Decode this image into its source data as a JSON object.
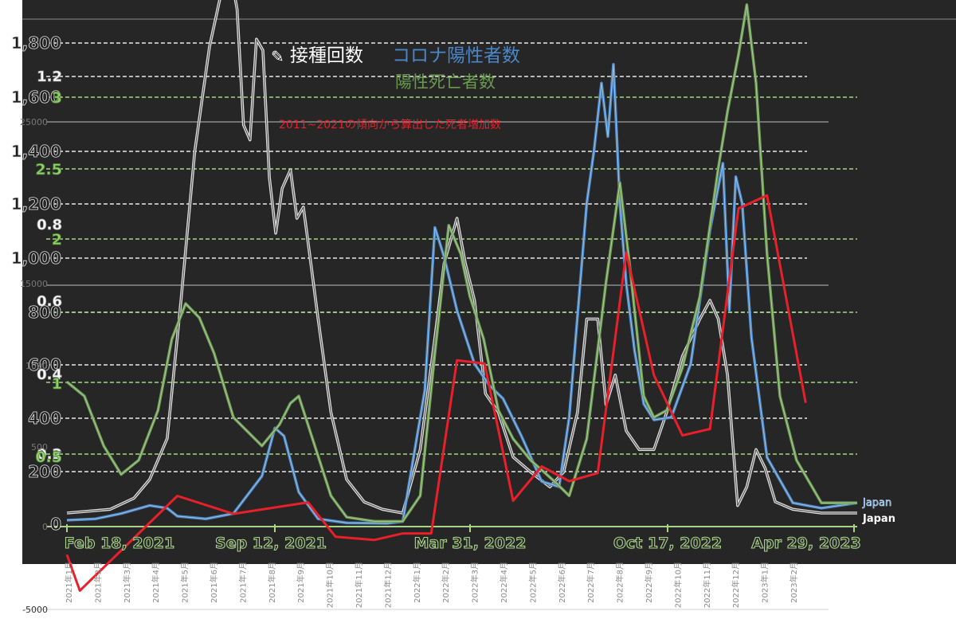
{
  "chart_data": {
    "type": "line",
    "legend": {
      "vaccinations": "接種回数",
      "cases": "コロナ陽性者数",
      "deaths": "陽性死亡者数",
      "excess": "2011~2021の傾向から算出した死者増加数"
    },
    "colors": {
      "vaccinations": "#f2f2f2",
      "cases": "#4a86c8",
      "deaths": "#6a9a50",
      "excess": "#e8202a",
      "background": "#262626",
      "grid_white": "#e8e8e8",
      "grid_green": "#a8d48a"
    },
    "axes": {
      "left_main_ticks": [
        "0",
        "200",
        "400",
        "600",
        "800",
        "1,000",
        "1,200",
        "1,400",
        "1,600",
        "1,800"
      ],
      "left_million_ticks": [
        "0.2",
        "0.4",
        "0.6",
        "0.8",
        "1.2"
      ],
      "left_green_ticks": [
        "0.5",
        "1",
        "2",
        "2.5",
        "3"
      ],
      "left_excess_ticks": [
        "0",
        "500",
        "1000",
        "15000",
        "25000",
        "-5000"
      ],
      "date_labels": [
        "Feb 18, 2021",
        "Sep 12, 2021",
        "Mar 31, 2022",
        "Oct 17, 2022",
        "Apr 29, 2023"
      ],
      "month_labels": [
        "2021年1月",
        "2021年2月",
        "2021年3月",
        "2021年4月",
        "2021年5月",
        "2021年6月",
        "2021年7月",
        "2021年8月",
        "2021年9月",
        "2021年10月",
        "2021年11月",
        "2021年12月",
        "2022年1月",
        "2022年2月",
        "2022年3月",
        "2022年4月",
        "2022年5月",
        "2022年6月",
        "2022年7月",
        "2022年8月",
        "2022年9月",
        "2022年10月",
        "2022年11月",
        "2022年12月",
        "2023年1月",
        "2023年2月"
      ]
    },
    "end_labels": {
      "cases": "Japan",
      "vaccinations": "Japan"
    },
    "x_start": "2021-01-01",
    "x_end": "2023-05-10",
    "series": [
      {
        "name": "接種回数",
        "key": "vaccinations",
        "points": [
          [
            "2021-01-01",
            0.03
          ],
          [
            "2021-02-17",
            0.04
          ],
          [
            "2021-03-15",
            0.07
          ],
          [
            "2021-04-01",
            0.12
          ],
          [
            "2021-04-20",
            0.23
          ],
          [
            "2021-05-05",
            0.6
          ],
          [
            "2021-05-20",
            1.0
          ],
          [
            "2021-06-05",
            1.28
          ],
          [
            "2021-06-20",
            1.45
          ],
          [
            "2021-06-27",
            1.49
          ],
          [
            "2021-07-05",
            1.38
          ],
          [
            "2021-07-12",
            1.07
          ],
          [
            "2021-07-19",
            1.03
          ],
          [
            "2021-07-26",
            1.3
          ],
          [
            "2021-08-02",
            1.27
          ],
          [
            "2021-08-09",
            0.93
          ],
          [
            "2021-08-16",
            0.78
          ],
          [
            "2021-08-23",
            0.9
          ],
          [
            "2021-09-01",
            0.95
          ],
          [
            "2021-09-08",
            0.82
          ],
          [
            "2021-09-15",
            0.85
          ],
          [
            "2021-09-22",
            0.72
          ],
          [
            "2021-10-01",
            0.55
          ],
          [
            "2021-10-15",
            0.3
          ],
          [
            "2021-11-01",
            0.12
          ],
          [
            "2021-11-20",
            0.06
          ],
          [
            "2021-12-10",
            0.04
          ],
          [
            "2022-01-01",
            0.03
          ],
          [
            "2022-01-20",
            0.2
          ],
          [
            "2022-02-05",
            0.5
          ],
          [
            "2022-02-15",
            0.7
          ],
          [
            "2022-03-01",
            0.82
          ],
          [
            "2022-03-10",
            0.7
          ],
          [
            "2022-03-20",
            0.6
          ],
          [
            "2022-04-01",
            0.35
          ],
          [
            "2022-04-15",
            0.3
          ],
          [
            "2022-05-01",
            0.18
          ],
          [
            "2022-05-20",
            0.14
          ],
          [
            "2022-06-10",
            0.1
          ],
          [
            "2022-06-25",
            0.14
          ],
          [
            "2022-07-10",
            0.3
          ],
          [
            "2022-07-20",
            0.55
          ],
          [
            "2022-08-01",
            0.55
          ],
          [
            "2022-08-10",
            0.32
          ],
          [
            "2022-08-20",
            0.4
          ],
          [
            "2022-09-01",
            0.25
          ],
          [
            "2022-09-15",
            0.2
          ],
          [
            "2022-10-01",
            0.2
          ],
          [
            "2022-10-15",
            0.3
          ],
          [
            "2022-11-01",
            0.45
          ],
          [
            "2022-11-20",
            0.55
          ],
          [
            "2022-12-01",
            0.6
          ],
          [
            "2022-12-10",
            0.55
          ],
          [
            "2022-12-20",
            0.4
          ],
          [
            "2022-12-31",
            0.05
          ],
          [
            "2023-01-10",
            0.1
          ],
          [
            "2023-01-20",
            0.2
          ],
          [
            "2023-01-30",
            0.15
          ],
          [
            "2023-02-10",
            0.06
          ],
          [
            "2023-03-01",
            0.04
          ],
          [
            "2023-04-01",
            0.03
          ],
          [
            "2023-05-10",
            0.03
          ]
        ]
      },
      {
        "name": "コロナ陽性者数",
        "key": "cases",
        "points": [
          [
            "2021-01-01",
            15
          ],
          [
            "2021-02-01",
            20
          ],
          [
            "2021-03-01",
            40
          ],
          [
            "2021-04-01",
            70
          ],
          [
            "2021-04-20",
            60
          ],
          [
            "2021-05-01",
            30
          ],
          [
            "2021-06-01",
            20
          ],
          [
            "2021-07-01",
            40
          ],
          [
            "2021-08-01",
            180
          ],
          [
            "2021-08-15",
            360
          ],
          [
            "2021-08-25",
            330
          ],
          [
            "2021-09-10",
            120
          ],
          [
            "2021-10-01",
            20
          ],
          [
            "2021-11-01",
            5
          ],
          [
            "2021-12-15",
            3
          ],
          [
            "2022-01-01",
            10
          ],
          [
            "2022-01-25",
            500
          ],
          [
            "2022-02-05",
            1110
          ],
          [
            "2022-02-15",
            1000
          ],
          [
            "2022-03-01",
            800
          ],
          [
            "2022-03-20",
            600
          ],
          [
            "2022-04-05",
            520
          ],
          [
            "2022-04-20",
            470
          ],
          [
            "2022-05-10",
            330
          ],
          [
            "2022-06-01",
            160
          ],
          [
            "2022-06-20",
            140
          ],
          [
            "2022-07-01",
            400
          ],
          [
            "2022-07-20",
            1200
          ],
          [
            "2022-07-28",
            1400
          ],
          [
            "2022-08-05",
            1650
          ],
          [
            "2022-08-12",
            1450
          ],
          [
            "2022-08-18",
            1720
          ],
          [
            "2022-08-25",
            1200
          ],
          [
            "2022-09-01",
            900
          ],
          [
            "2022-09-10",
            650
          ],
          [
            "2022-09-20",
            450
          ],
          [
            "2022-10-01",
            390
          ],
          [
            "2022-10-20",
            400
          ],
          [
            "2022-11-10",
            600
          ],
          [
            "2022-12-01",
            1100
          ],
          [
            "2022-12-15",
            1350
          ],
          [
            "2022-12-22",
            800
          ],
          [
            "2022-12-29",
            1300
          ],
          [
            "2023-01-05",
            1200
          ],
          [
            "2023-01-15",
            700
          ],
          [
            "2023-02-01",
            250
          ],
          [
            "2023-03-01",
            80
          ],
          [
            "2023-04-01",
            60
          ],
          [
            "2023-05-10",
            80
          ]
        ]
      },
      {
        "name": "陽性死亡者数",
        "key": "deaths",
        "points": [
          [
            "2021-01-01",
            1.0
          ],
          [
            "2021-01-20",
            0.9
          ],
          [
            "2021-02-10",
            0.55
          ],
          [
            "2021-03-01",
            0.35
          ],
          [
            "2021-03-20",
            0.45
          ],
          [
            "2021-04-10",
            0.8
          ],
          [
            "2021-04-25",
            1.3
          ],
          [
            "2021-05-10",
            1.55
          ],
          [
            "2021-05-25",
            1.45
          ],
          [
            "2021-06-10",
            1.2
          ],
          [
            "2021-07-01",
            0.75
          ],
          [
            "2021-08-01",
            0.55
          ],
          [
            "2021-08-20",
            0.7
          ],
          [
            "2021-09-01",
            0.85
          ],
          [
            "2021-09-10",
            0.9
          ],
          [
            "2021-09-25",
            0.6
          ],
          [
            "2021-10-15",
            0.2
          ],
          [
            "2021-11-01",
            0.05
          ],
          [
            "2021-12-01",
            0.02
          ],
          [
            "2022-01-01",
            0.02
          ],
          [
            "2022-01-20",
            0.2
          ],
          [
            "2022-02-05",
            1.2
          ],
          [
            "2022-02-20",
            2.1
          ],
          [
            "2022-03-05",
            1.9
          ],
          [
            "2022-03-15",
            1.6
          ],
          [
            "2022-03-30",
            1.3
          ],
          [
            "2022-04-15",
            0.8
          ],
          [
            "2022-05-01",
            0.6
          ],
          [
            "2022-05-20",
            0.45
          ],
          [
            "2022-06-15",
            0.3
          ],
          [
            "2022-07-01",
            0.2
          ],
          [
            "2022-07-20",
            0.6
          ],
          [
            "2022-08-10",
            1.7
          ],
          [
            "2022-08-25",
            2.4
          ],
          [
            "2022-09-05",
            1.8
          ],
          [
            "2022-09-20",
            0.9
          ],
          [
            "2022-10-01",
            0.75
          ],
          [
            "2022-10-15",
            0.8
          ],
          [
            "2022-11-01",
            1.1
          ],
          [
            "2022-11-20",
            1.6
          ],
          [
            "2022-12-10",
            2.5
          ],
          [
            "2022-12-20",
            2.9
          ],
          [
            "2023-01-01",
            3.3
          ],
          [
            "2023-01-10",
            3.65
          ],
          [
            "2023-01-20",
            3.1
          ],
          [
            "2023-02-01",
            1.9
          ],
          [
            "2023-02-15",
            0.9
          ],
          [
            "2023-03-05",
            0.45
          ],
          [
            "2023-04-01",
            0.15
          ],
          [
            "2023-05-10",
            0.15
          ]
        ]
      },
      {
        "name": "2011~2021の傾向から算出した死者増加数",
        "key": "excess",
        "points": [
          [
            "2021-01-01",
            -1500
          ],
          [
            "2021-01-15",
            -3700
          ],
          [
            "2021-05-01",
            2100
          ],
          [
            "2021-07-01",
            1000
          ],
          [
            "2021-09-20",
            1700
          ],
          [
            "2021-10-20",
            -400
          ],
          [
            "2021-12-01",
            -600
          ],
          [
            "2022-01-01",
            -200
          ],
          [
            "2022-02-01",
            -200
          ],
          [
            "2022-03-01",
            10400
          ],
          [
            "2022-03-31",
            10200
          ],
          [
            "2022-05-01",
            1800
          ],
          [
            "2022-06-01",
            3900
          ],
          [
            "2022-07-01",
            3000
          ],
          [
            "2022-08-01",
            3500
          ],
          [
            "2022-09-01",
            17000
          ],
          [
            "2022-10-01",
            9500
          ],
          [
            "2022-11-01",
            5800
          ],
          [
            "2022-12-01",
            6200
          ],
          [
            "2023-01-01",
            19700
          ],
          [
            "2023-02-01",
            20500
          ],
          [
            "2023-03-15",
            7800
          ]
        ]
      }
    ]
  }
}
